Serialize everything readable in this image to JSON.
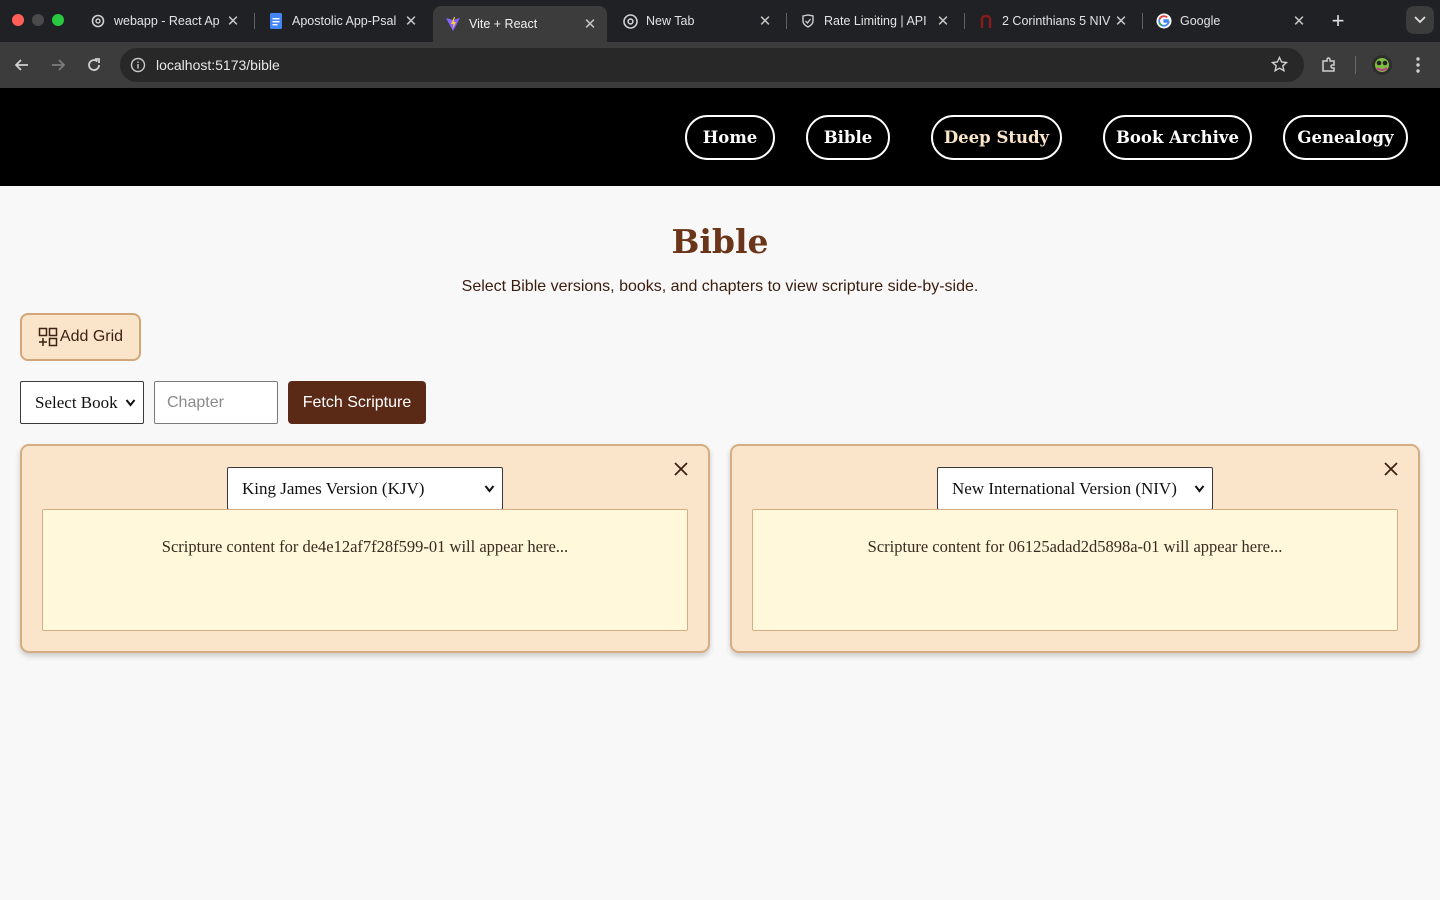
{
  "browser": {
    "tabs": [
      {
        "title": "webapp - React Ap",
        "icon": "openai-icon"
      },
      {
        "title": "Apostolic App-Psal",
        "icon": "google-docs-icon"
      },
      {
        "title": "Vite + React",
        "icon": "vite-icon",
        "active": true
      },
      {
        "title": "New Tab",
        "icon": "chrome-icon"
      },
      {
        "title": "Rate Limiting | API",
        "icon": "shield-icon"
      },
      {
        "title": "2 Corinthians 5 NIV",
        "icon": "biblegateway-icon"
      },
      {
        "title": "Google",
        "icon": "google-icon"
      }
    ],
    "url": "localhost:5173/bible"
  },
  "nav": {
    "items": [
      "Home",
      "Bible",
      "Deep Study",
      "Book Archive",
      "Genealogy"
    ]
  },
  "page": {
    "title": "Bible",
    "subtitle": "Select Bible versions, books, and chapters to view scripture side-by-side."
  },
  "controls": {
    "add_grid_label": "Add Grid",
    "book_select_value": "Select Book",
    "chapter_placeholder": "Chapter",
    "fetch_label": "Fetch Scripture"
  },
  "grids": [
    {
      "version": "King James Version (KJV)",
      "content": "Scripture content for de4e12af7f28f599-01 will appear here..."
    },
    {
      "version": "New International Version (NIV)",
      "content": "Scripture content for 06125adad2d5898a-01 will appear here..."
    }
  ],
  "colors": {
    "header_bg": "#000000",
    "title_brown": "#6b3519",
    "card_bg": "#fbe5ca",
    "card_border": "#d4ad84",
    "scripture_bg": "#fff8db",
    "fetch_button": "#5a2a16"
  }
}
